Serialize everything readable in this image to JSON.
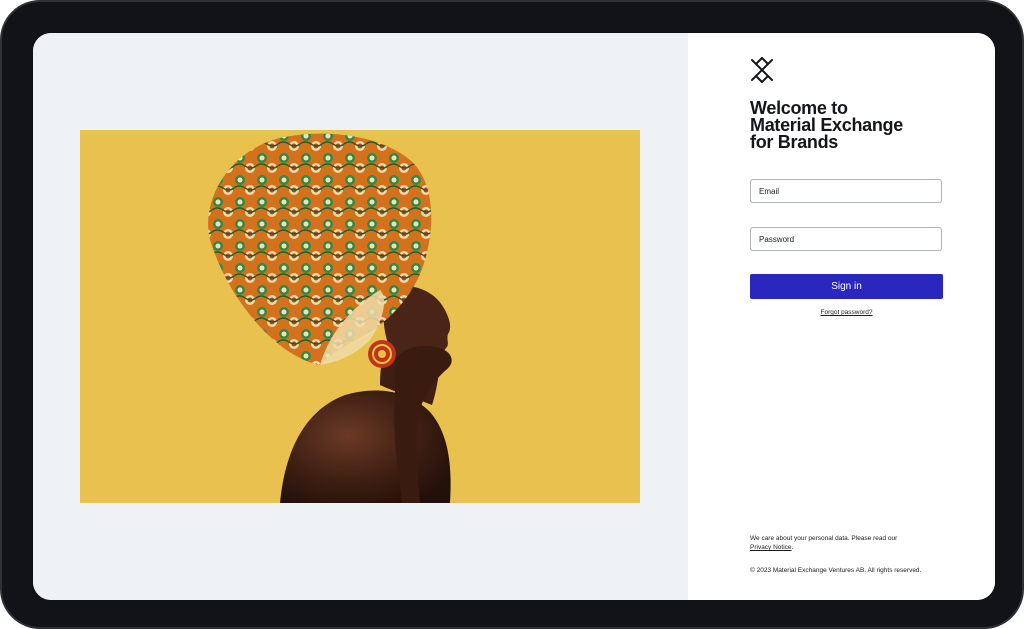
{
  "brand": {
    "logo_icon": "crossed-x-diamond-logo",
    "accent_color": "#2a27bf"
  },
  "welcome": {
    "line1": "Welcome to",
    "line2": "Material Exchange",
    "line3": "for Brands"
  },
  "form": {
    "email_placeholder": "Email",
    "password_placeholder": "Password",
    "signin_label": "Sign in",
    "forgot_label": "Forgot password?"
  },
  "footer": {
    "privacy_text": "We care about your personal data. Please read our",
    "privacy_link": "Privacy Notice",
    "privacy_suffix": ".",
    "copyright": "© 2023 Material Exchange Ventures AB. All rights reserved."
  },
  "hero": {
    "subject": "woman wearing patterned head wrap on yellow background",
    "background_color": "#e8c14e"
  }
}
